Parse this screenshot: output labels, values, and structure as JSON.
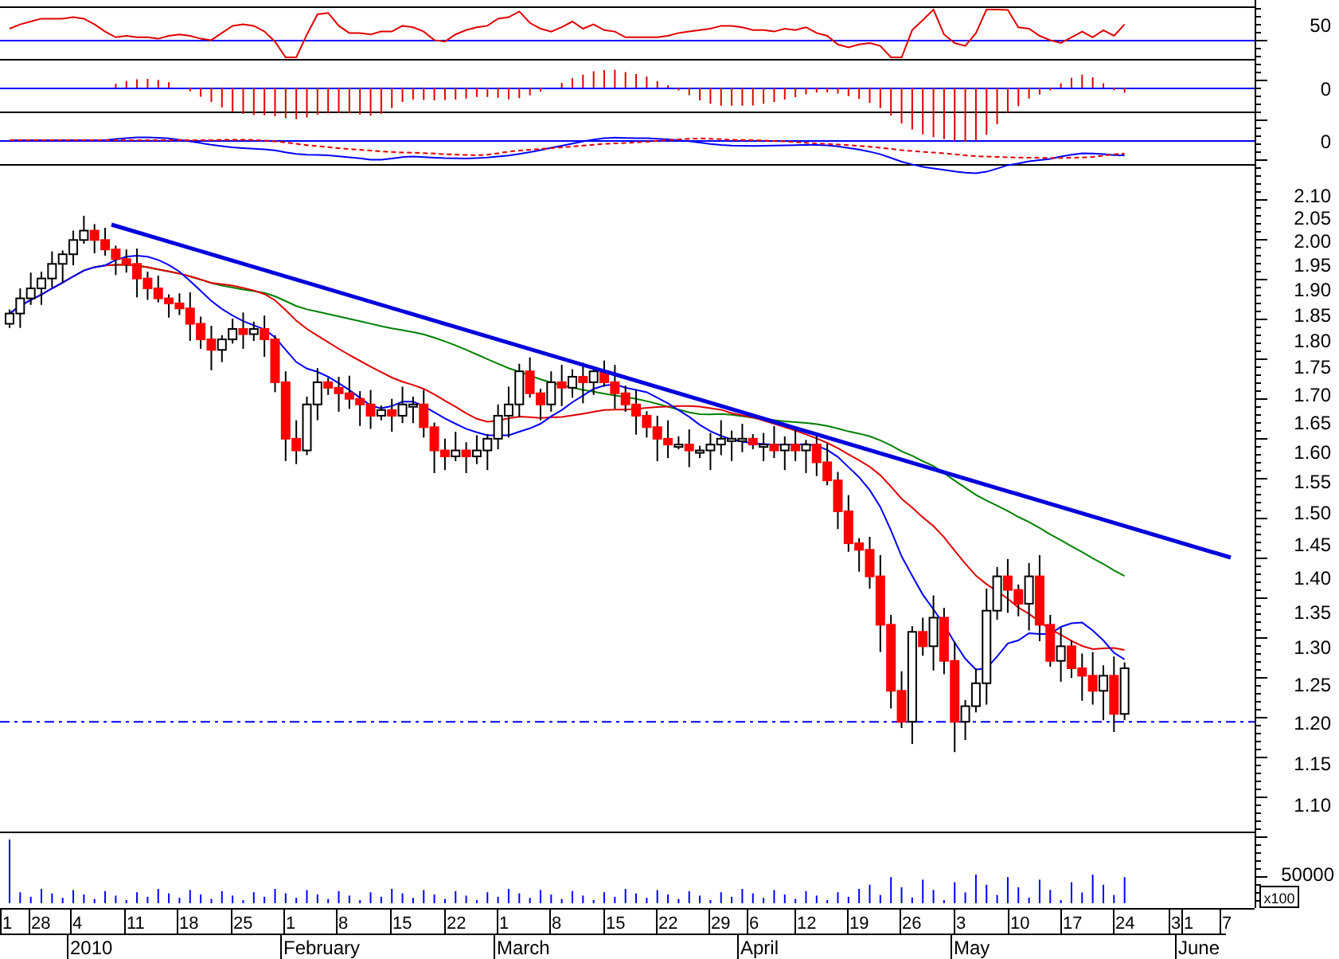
{
  "indicator_axis": [
    {
      "label": "50"
    },
    {
      "label": "0"
    },
    {
      "label": "0"
    }
  ],
  "price_axis": {
    "ticks": [
      "2.10",
      "2.05",
      "2.00",
      "1.95",
      "1.90",
      "1.85",
      "1.80",
      "1.75",
      "1.70",
      "1.65",
      "1.60",
      "1.55",
      "1.50",
      "1.45",
      "1.40",
      "1.35",
      "1.30",
      "1.25",
      "1.20",
      "1.15",
      "1.10"
    ]
  },
  "volume_axis": {
    "label": "50000",
    "unit": "x100"
  },
  "date_axis": {
    "days": [
      "1",
      "28",
      "4",
      "11",
      "18",
      "25",
      "1",
      "8",
      "15",
      "22",
      "1",
      "8",
      "15",
      "22",
      "29",
      "6",
      "12",
      "19",
      "26",
      "3",
      "10",
      "17",
      "24",
      "3",
      "1",
      "7"
    ],
    "months": [
      "2010",
      "February",
      "March",
      "April",
      "May",
      "June"
    ]
  }
}
